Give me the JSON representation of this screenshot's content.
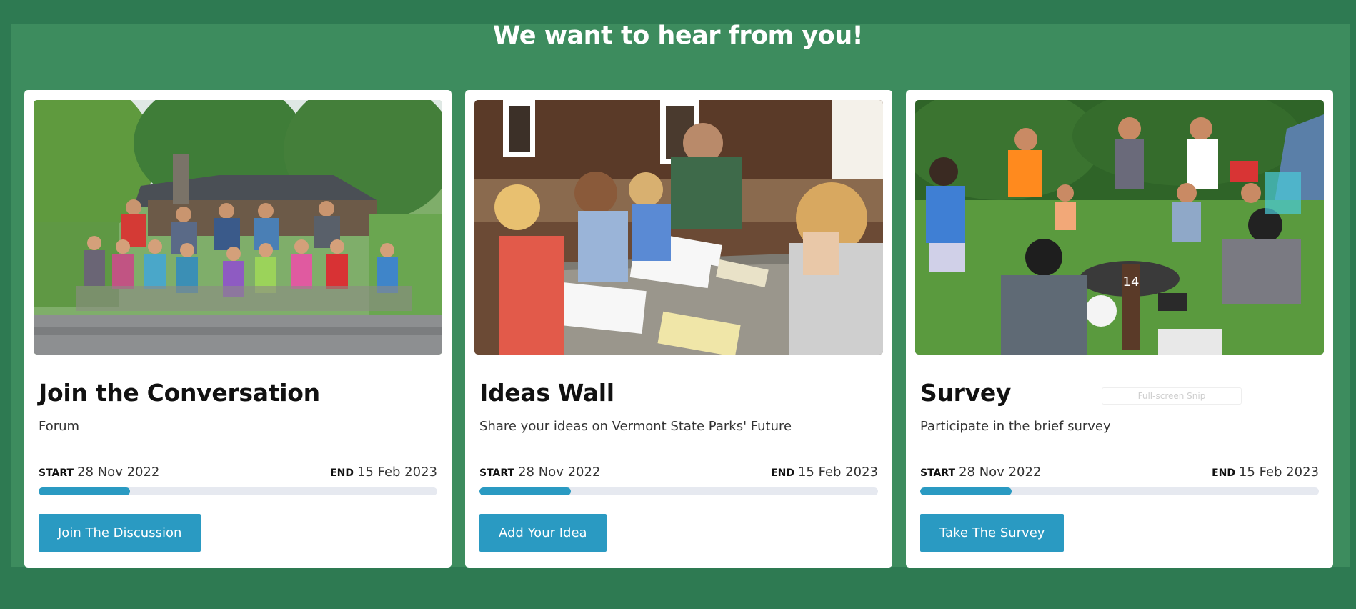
{
  "header": {
    "title": "We want to hear from you!"
  },
  "cards": [
    {
      "title": "Join the Conversation",
      "description": "Forum",
      "start_label": "START",
      "start_date": "28 Nov 2022",
      "end_label": "END",
      "end_date": "15 Feb 2023",
      "progress_fraction": 0.23,
      "button_label": "Join The Discussion",
      "image_subject": "group-photo-outside-cabin"
    },
    {
      "title": "Ideas Wall",
      "description": "Share your ideas on Vermont State Parks' Future",
      "start_label": "START",
      "start_date": "28 Nov 2022",
      "end_label": "END",
      "end_date": "15 Feb 2023",
      "progress_fraction": 0.23,
      "button_label": "Add Your Idea",
      "image_subject": "children-at-picnic-table"
    },
    {
      "title": "Survey",
      "description": "Participate in the brief survey",
      "start_label": "START",
      "start_date": "28 Nov 2022",
      "end_label": "END",
      "end_date": "15 Feb 2023",
      "progress_fraction": 0.23,
      "button_label": "Take The Survey",
      "image_subject": "kids-at-campfire",
      "overlay_label": "Full-screen Snip"
    }
  ],
  "colors": {
    "page_background": "#2e7a52",
    "panel_background": "#3d8c5e",
    "accent": "#2a9ac2",
    "progress_track": "#e6e9f0"
  }
}
